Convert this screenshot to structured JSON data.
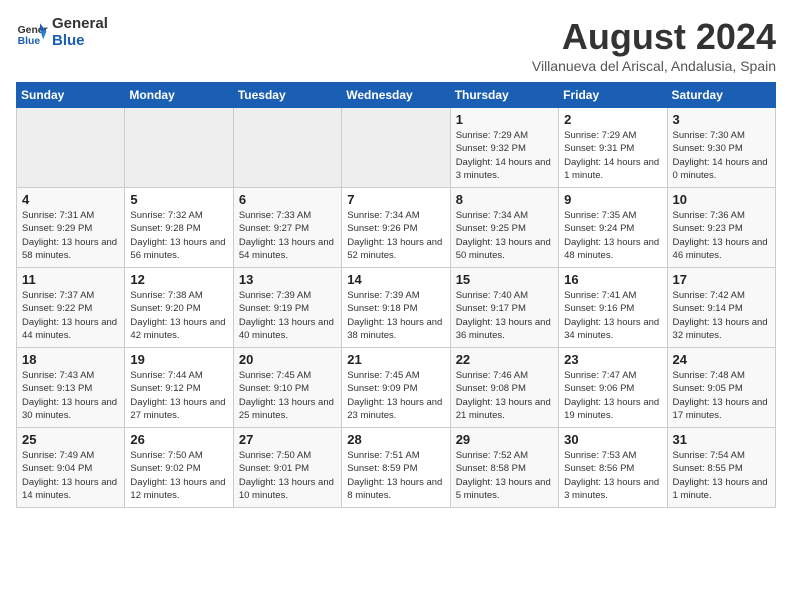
{
  "header": {
    "logo_line1": "General",
    "logo_line2": "Blue",
    "month": "August 2024",
    "location": "Villanueva del Ariscal, Andalusia, Spain"
  },
  "weekdays": [
    "Sunday",
    "Monday",
    "Tuesday",
    "Wednesday",
    "Thursday",
    "Friday",
    "Saturday"
  ],
  "weeks": [
    [
      {
        "day": "",
        "empty": true
      },
      {
        "day": "",
        "empty": true
      },
      {
        "day": "",
        "empty": true
      },
      {
        "day": "",
        "empty": true
      },
      {
        "day": "1",
        "rise": "7:29 AM",
        "set": "9:32 PM",
        "daylight": "14 hours and 3 minutes."
      },
      {
        "day": "2",
        "rise": "7:29 AM",
        "set": "9:31 PM",
        "daylight": "14 hours and 1 minute."
      },
      {
        "day": "3",
        "rise": "7:30 AM",
        "set": "9:30 PM",
        "daylight": "14 hours and 0 minutes."
      }
    ],
    [
      {
        "day": "4",
        "rise": "7:31 AM",
        "set": "9:29 PM",
        "daylight": "13 hours and 58 minutes."
      },
      {
        "day": "5",
        "rise": "7:32 AM",
        "set": "9:28 PM",
        "daylight": "13 hours and 56 minutes."
      },
      {
        "day": "6",
        "rise": "7:33 AM",
        "set": "9:27 PM",
        "daylight": "13 hours and 54 minutes."
      },
      {
        "day": "7",
        "rise": "7:34 AM",
        "set": "9:26 PM",
        "daylight": "13 hours and 52 minutes."
      },
      {
        "day": "8",
        "rise": "7:34 AM",
        "set": "9:25 PM",
        "daylight": "13 hours and 50 minutes."
      },
      {
        "day": "9",
        "rise": "7:35 AM",
        "set": "9:24 PM",
        "daylight": "13 hours and 48 minutes."
      },
      {
        "day": "10",
        "rise": "7:36 AM",
        "set": "9:23 PM",
        "daylight": "13 hours and 46 minutes."
      }
    ],
    [
      {
        "day": "11",
        "rise": "7:37 AM",
        "set": "9:22 PM",
        "daylight": "13 hours and 44 minutes."
      },
      {
        "day": "12",
        "rise": "7:38 AM",
        "set": "9:20 PM",
        "daylight": "13 hours and 42 minutes."
      },
      {
        "day": "13",
        "rise": "7:39 AM",
        "set": "9:19 PM",
        "daylight": "13 hours and 40 minutes."
      },
      {
        "day": "14",
        "rise": "7:39 AM",
        "set": "9:18 PM",
        "daylight": "13 hours and 38 minutes."
      },
      {
        "day": "15",
        "rise": "7:40 AM",
        "set": "9:17 PM",
        "daylight": "13 hours and 36 minutes."
      },
      {
        "day": "16",
        "rise": "7:41 AM",
        "set": "9:16 PM",
        "daylight": "13 hours and 34 minutes."
      },
      {
        "day": "17",
        "rise": "7:42 AM",
        "set": "9:14 PM",
        "daylight": "13 hours and 32 minutes."
      }
    ],
    [
      {
        "day": "18",
        "rise": "7:43 AM",
        "set": "9:13 PM",
        "daylight": "13 hours and 30 minutes."
      },
      {
        "day": "19",
        "rise": "7:44 AM",
        "set": "9:12 PM",
        "daylight": "13 hours and 27 minutes."
      },
      {
        "day": "20",
        "rise": "7:45 AM",
        "set": "9:10 PM",
        "daylight": "13 hours and 25 minutes."
      },
      {
        "day": "21",
        "rise": "7:45 AM",
        "set": "9:09 PM",
        "daylight": "13 hours and 23 minutes."
      },
      {
        "day": "22",
        "rise": "7:46 AM",
        "set": "9:08 PM",
        "daylight": "13 hours and 21 minutes."
      },
      {
        "day": "23",
        "rise": "7:47 AM",
        "set": "9:06 PM",
        "daylight": "13 hours and 19 minutes."
      },
      {
        "day": "24",
        "rise": "7:48 AM",
        "set": "9:05 PM",
        "daylight": "13 hours and 17 minutes."
      }
    ],
    [
      {
        "day": "25",
        "rise": "7:49 AM",
        "set": "9:04 PM",
        "daylight": "13 hours and 14 minutes."
      },
      {
        "day": "26",
        "rise": "7:50 AM",
        "set": "9:02 PM",
        "daylight": "13 hours and 12 minutes."
      },
      {
        "day": "27",
        "rise": "7:50 AM",
        "set": "9:01 PM",
        "daylight": "13 hours and 10 minutes."
      },
      {
        "day": "28",
        "rise": "7:51 AM",
        "set": "8:59 PM",
        "daylight": "13 hours and 8 minutes."
      },
      {
        "day": "29",
        "rise": "7:52 AM",
        "set": "8:58 PM",
        "daylight": "13 hours and 5 minutes."
      },
      {
        "day": "30",
        "rise": "7:53 AM",
        "set": "8:56 PM",
        "daylight": "13 hours and 3 minutes."
      },
      {
        "day": "31",
        "rise": "7:54 AM",
        "set": "8:55 PM",
        "daylight": "13 hours and 1 minute."
      }
    ]
  ]
}
